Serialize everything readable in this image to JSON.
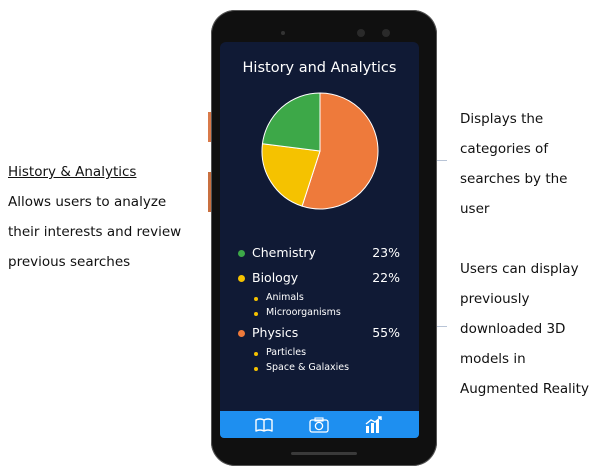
{
  "left": {
    "title": "History & Analytics",
    "lines": [
      "Allows users to analyze",
      "their interests and review",
      "previous searches"
    ]
  },
  "right_top": {
    "lines": [
      "Displays the",
      "categories of",
      "searches by the",
      "user"
    ]
  },
  "right_bottom": {
    "lines": [
      "Users can display",
      "previously",
      "downloaded 3D",
      "models in",
      "Augmented Reality"
    ]
  },
  "screen": {
    "title": "History and Analytics",
    "categories": [
      {
        "label": "Chemistry",
        "percent": "23%",
        "color": "#3da848",
        "subitems": []
      },
      {
        "label": "Biology",
        "percent": "22%",
        "color": "#f5c200",
        "subitems": [
          "Animals",
          "Microorganisms"
        ]
      },
      {
        "label": "Physics",
        "percent": "55%",
        "color": "#ee7a3b",
        "subitems": [
          "Particles",
          "Space & Galaxies"
        ]
      }
    ],
    "nav": [
      {
        "icon": "book-icon",
        "active": false
      },
      {
        "icon": "camera-icon",
        "active": false
      },
      {
        "icon": "analytics-icon",
        "active": true
      }
    ],
    "nav_color": "#1e8ff0"
  },
  "chart_data": {
    "type": "pie",
    "categories": [
      "Chemistry",
      "Biology",
      "Physics"
    ],
    "values": [
      23,
      22,
      55
    ],
    "colors": [
      "#3da848",
      "#f5c200",
      "#ee7a3b"
    ]
  }
}
